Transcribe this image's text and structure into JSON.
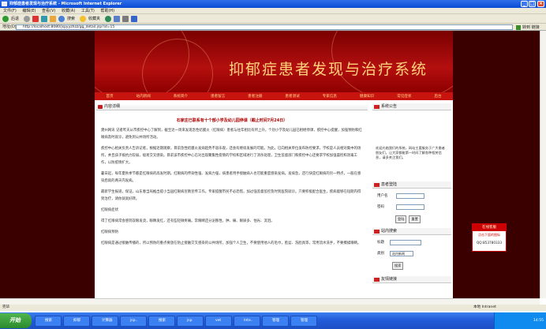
{
  "window": {
    "title": "抑郁症患者发现与治疗系统 - Microsoft Internet Explorer"
  },
  "menu": [
    "文件(F)",
    "编辑(E)",
    "查看(V)",
    "收藏(A)",
    "工具(T)",
    "帮助(H)"
  ],
  "toolbar": {
    "back": "后退",
    "search": "搜索",
    "favorites": "收藏夹"
  },
  "address": {
    "label": "地址(D)",
    "url": "http://localhost:8080/jspyyzhzz/gg_detail.jsp?id=15",
    "go": "转到",
    "links": "链接"
  },
  "site": {
    "banner_title": "抑郁症患者发现与治疗系统"
  },
  "nav": [
    "首页",
    "站内新闻",
    "系统简介",
    "患者留言",
    "患者注册",
    "患者测试",
    "专家信息",
    "健康知识",
    "常见症状",
    "后台"
  ],
  "main": {
    "section_title": "内容详细",
    "article_title": "石家庄已联系有十个部小学及幼儿园停课（截止时间7月24日）",
    "paragraphs": [
      "建州网讯 记者昨天从市疾控中心了解到，截至近一周来发现急性结膜炎（红眼病）患者与往年相比有所上升，个别小学及幼儿园已相继停课，疾控中心提醒，加强预防和红眼病及时就诊，避免到公共场所活动。",
      "疾控中心相关负责人告诉记者，根据近期观察，目前急性结膜炎发病趋势不容乐观，还会有继续发展的可能。为此，已向相关单位发布防控要求，学校是人员相对集中的场所，并且孩子抵抗力较弱，极易交叉感染。目前该市疾控中心已对出现聚集性疫情的学校和区域进行了消杀处理，卫生监督部门和疾控中心还要求学校加强晨检和消毒工作，以防疫情扩大。",
      "暑日起，每年夏秋季节都是红眼病的高发时期。红眼病的传染性强、发病力强，病患者用手接触病人也可能重度感染发病。发病急，还行快是红眼病的另一特点，一般在感染后就的两天内发病。",
      "最新学生报道，保证，山东春当局推出提小当园红眼病宣教宣传工作。专家提醒市民不必恐慌，加过强监督监控及时到医院就诊。只要积极配合医生，疾病能够在短期内得到治疗，请你就就好转。",
      "红眼病症状",
      "得了红眼病常会感到双眼发烫，眼睛发红，还有些轻微疼痛。常眼睛还分泌脓性，肿、痛、眼屎多、怕光、流泪。",
      "红眼病预防",
      "红眼病是通过接触传播的，所以预防的重点要放在防止接触交叉感染的公共场所，加强个人卫生，不要使用他人的毛巾，脸盆、洗脸具等，常用流水洗手，不要擦揉眼睛。"
    ]
  },
  "side": {
    "notice_title": "系统公告",
    "notice_text": "欢迎光临我们的系统，网站主要服务于广大患者朋友们，让大家都能第一时间了解各种相关信息，请多关注我们。",
    "login_title": "患者登陆",
    "user_label": "用户名",
    "pass_label": "密码",
    "login_btn": "登陆",
    "reset_btn": "重置",
    "search_title": "站内搜索",
    "kw_label": "标题",
    "type_label": "类别",
    "type_value": "站内新闻",
    "search_btn": "搜索",
    "more_title": "友情链接"
  },
  "float": {
    "title": "在线客服",
    "line": "点击下面的图标",
    "qq": "QQ:853780333"
  },
  "status": {
    "text": "完毕",
    "zone": "本地 Intranet"
  },
  "taskbar": {
    "start": "开始",
    "tasks": [
      "搜索",
      "抑郁",
      "计算器",
      "jsp..",
      "搜索",
      "jsp",
      "vet",
      "Inte..",
      "管理",
      "管理"
    ],
    "clock": "14:55"
  }
}
